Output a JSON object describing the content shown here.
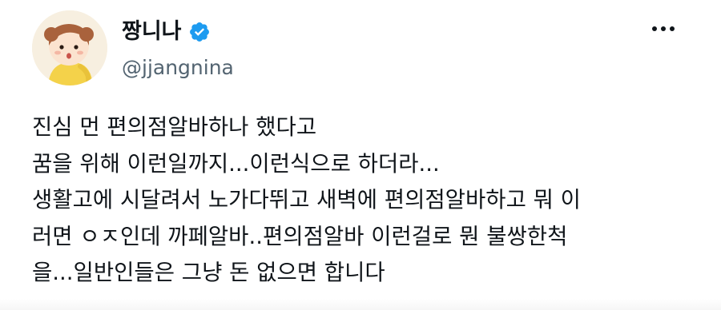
{
  "author": {
    "display_name": "짱니나",
    "handle": "@jjangnina",
    "verified": true,
    "avatar_icon": "cartoon-girl-avatar"
  },
  "menu": {
    "more_icon": "more-horizontal-icon"
  },
  "tweet": {
    "lines": [
      "진심 먼 편의점알바하나 했다고",
      "꿈을 위해 이런일까지...이런식으로 하더라...",
      "생활고에 시달려서 노가다뛰고 새벽에 편의점알바하고 뭐 이",
      "러면 ㅇㅈ인데 까페알바..편의점알바 이런걸로 뭔 불쌍한척",
      "을...일반인들은 그냥 돈 없으면 합니다"
    ]
  },
  "colors": {
    "text": "#0f1419",
    "muted": "#536471",
    "verified_blue": "#1d9bf0"
  }
}
